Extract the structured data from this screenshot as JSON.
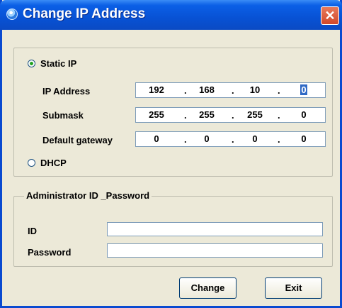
{
  "window": {
    "title": "Change IP Address",
    "close_glyph": "✕"
  },
  "mode": {
    "static_label": "Static IP",
    "dhcp_label": "DHCP",
    "selected": "Static IP"
  },
  "fields": {
    "ip_label": "IP Address",
    "submask_label": "Submask",
    "gateway_label": "Default gateway",
    "ip": [
      "192",
      "168",
      "10",
      "0"
    ],
    "submask": [
      "255",
      "255",
      "255",
      "0"
    ],
    "gateway": [
      "0",
      "0",
      "0",
      "0"
    ],
    "separator": "."
  },
  "admin": {
    "legend": "Administrator ID _Password",
    "id_label": "ID",
    "password_label": "Password",
    "id_value": "",
    "password_value": ""
  },
  "buttons": {
    "change": "Change",
    "exit": "Exit"
  }
}
